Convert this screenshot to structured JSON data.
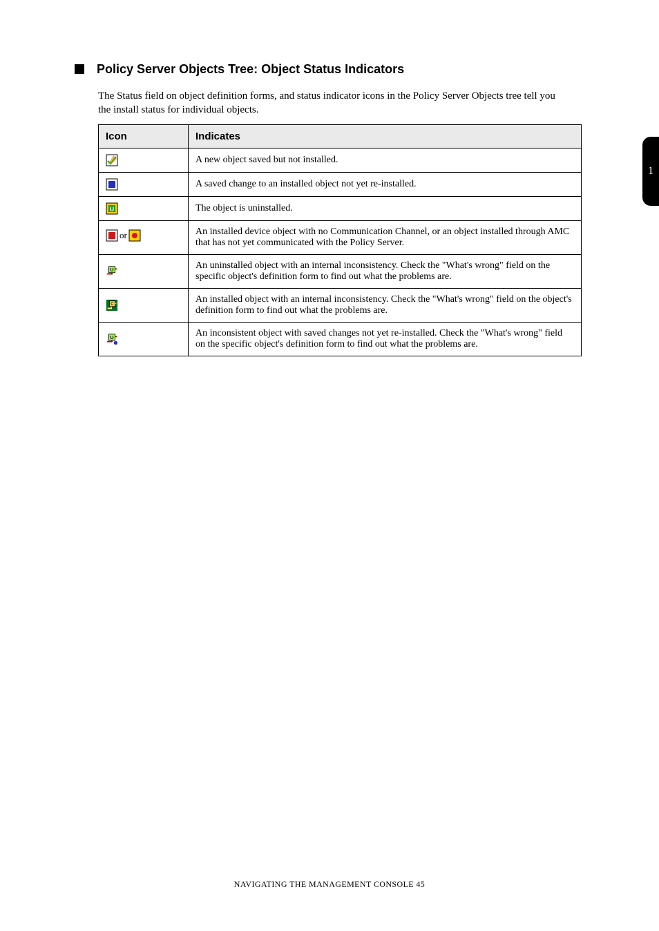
{
  "section": {
    "heading": "Policy Server Objects Tree: Object Status Indicators",
    "lead": "The Status field on object definition forms, and status indicator icons in the Policy Server Objects tree tell you the install status for individual objects."
  },
  "tab": {
    "label": "1"
  },
  "table": {
    "headers": [
      "Icon",
      "Indicates"
    ],
    "rows": [
      {
        "iconKey": "check-pencil",
        "text": "A new object saved but not installed."
      },
      {
        "iconKey": "box-blue",
        "text": "A saved change to an installed object not yet re-installed."
      },
      {
        "iconKey": "box-green-u",
        "text": "The object is uninstalled."
      },
      {
        "iconKey": "box-red-pair",
        "text": "An installed device object with no Communication Channel, or an object installed through AMC that has not yet communicated with the Policy Server."
      },
      {
        "iconKey": "share-u",
        "text": "An uninstalled object with an internal inconsistency. Check the \"What's wrong\" field on the specific object's definition form to find out what the problems are."
      },
      {
        "iconKey": "share-c",
        "text": "An installed object with an internal inconsistency. Check the \"What's wrong\" field on the object's definition form to find out what the problems are."
      },
      {
        "iconKey": "share-u2",
        "text": "An inconsistent object with saved changes not yet re-installed. Check the \"What's wrong\" field on the specific object's definition form to find out what the problems are."
      }
    ]
  },
  "footer": "NAVIGATING THE MANAGEMENT CONSOLE  45",
  "icons": {
    "check-pencil": "check-pencil",
    "box-blue": "box-blue",
    "box-green-u": "box-green-u",
    "box-red-pair": "box-red-pair",
    "share-u": "share-u",
    "share-c": "share-c",
    "share-u2": "share-u2"
  }
}
